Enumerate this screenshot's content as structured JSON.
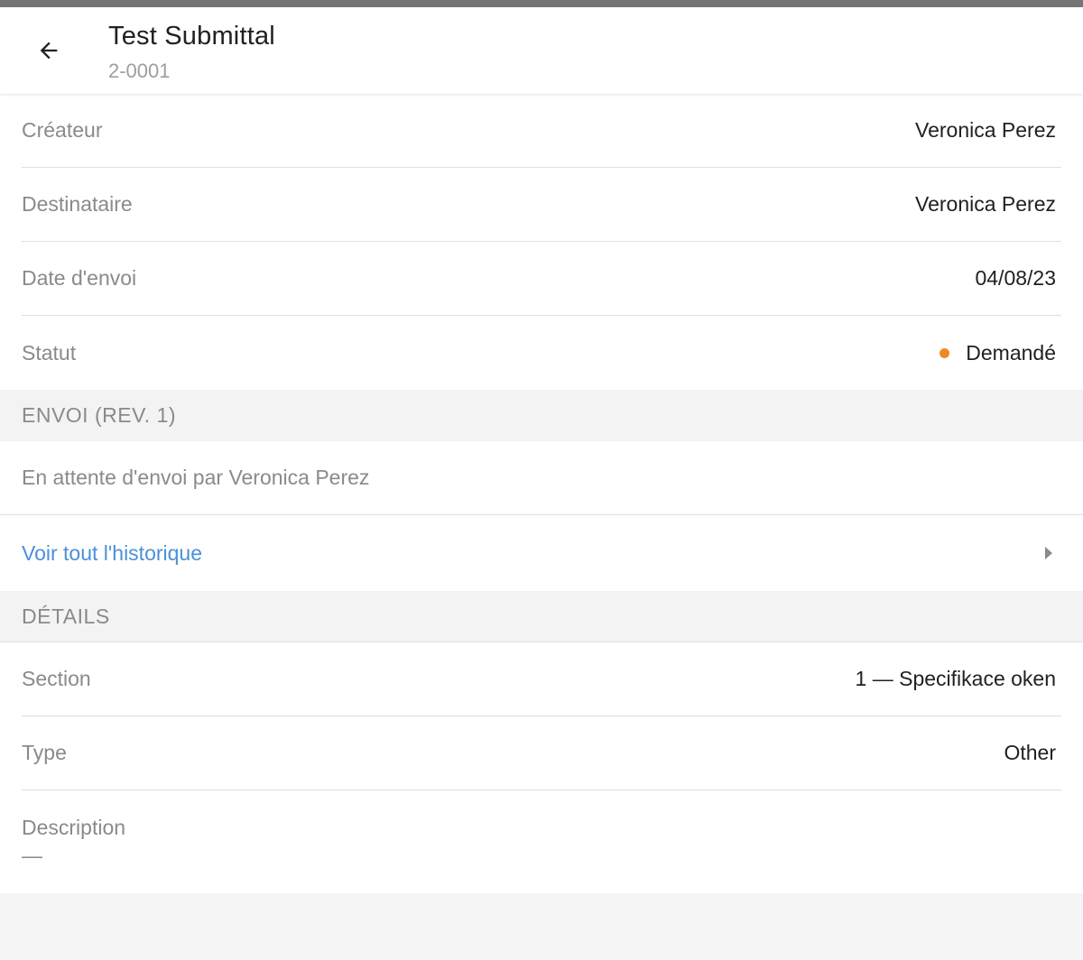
{
  "header": {
    "title": "Test Submittal",
    "subtitle": "2-0001"
  },
  "info_rows": [
    {
      "label": "Créateur",
      "value": "Veronica Perez"
    },
    {
      "label": "Destinataire",
      "value": "Veronica Perez"
    },
    {
      "label": "Date d'envoi",
      "value": "04/08/23"
    },
    {
      "label": "Statut",
      "value": "Demandé",
      "status_color": "#f0882a"
    }
  ],
  "envoi_section": {
    "title": "ENVOI (REV. 1)",
    "pending_text": "En attente d'envoi par Veronica Perez",
    "history_link": "Voir tout l'historique"
  },
  "details_section": {
    "title": "DÉTAILS",
    "rows": [
      {
        "label": "Section",
        "value": "1 — Specifikace oken"
      },
      {
        "label": "Type",
        "value": "Other"
      }
    ],
    "description_label": "Description",
    "description_value": "—"
  },
  "colors": {
    "link": "#4a90d9",
    "status_dot": "#f0882a"
  },
  "icons": {
    "back": "arrow-left-icon",
    "history_chevron": "chevron-right-icon"
  }
}
